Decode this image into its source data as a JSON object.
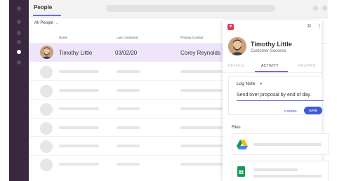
{
  "header": {
    "title": "People"
  },
  "list": {
    "filter_label": "All People",
    "columns": [
      "Name",
      "Last Contacted",
      "Primary Contact"
    ],
    "selected_row": {
      "name": "Timothy Little",
      "last_contacted": "03/02/20",
      "primary_contact": "Corey Reynolds"
    }
  },
  "panel": {
    "name": "Timothy Little",
    "role": "Customer Success",
    "tabs": [
      "DETAILS",
      "ACTIVITY",
      "RELATED"
    ],
    "active_tab": "ACTIVITY",
    "note": {
      "type_label": "Log Note",
      "text": "Send over proposal by end of day.",
      "cancel_label": "CANCEL",
      "save_label": "SAVE"
    },
    "files_label": "Files",
    "files": [
      {
        "icon": "google-drive-icon"
      },
      {
        "icon": "google-sheets-icon"
      }
    ]
  },
  "colors": {
    "accent": "#6b6ce0",
    "rail": "#3a2840",
    "selected_row": "#efe5fa",
    "save": "#3d5bd8"
  }
}
